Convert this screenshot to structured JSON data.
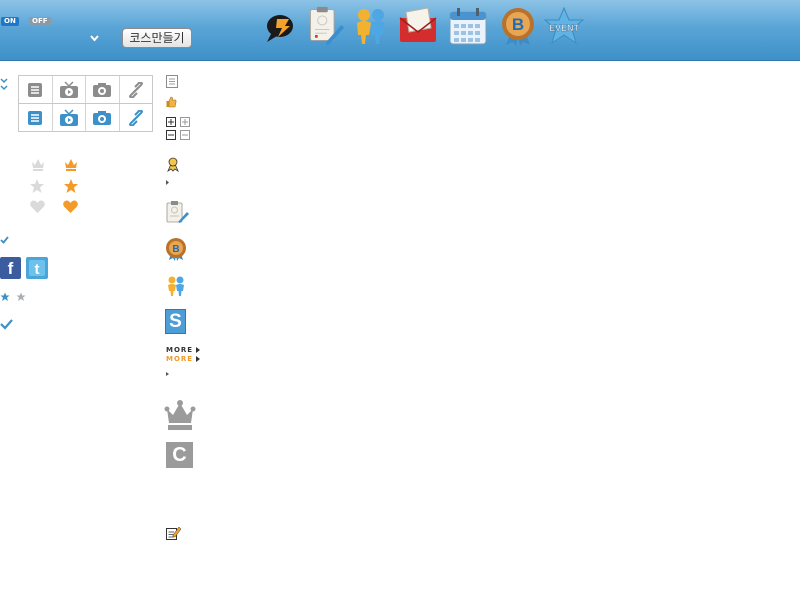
{
  "topbar": {
    "toggle_on": "ON",
    "toggle_off": "OFF",
    "course_button_label": "코스만들기",
    "event_label": "EVENT",
    "badge_letter": "B",
    "icons": [
      "speech-bubble-icon",
      "clipboard-icon",
      "friends-icon",
      "mail-icon",
      "calendar-icon",
      "badge-b-icon",
      "event-star-icon"
    ]
  },
  "sidebar_links": {
    "more_label_1": "MORE",
    "more_label_2": "MORE"
  },
  "labels": {
    "c_letter": "C",
    "s_letter": "S",
    "fb_letter": "f",
    "tw_letter": "t"
  },
  "colors": {
    "accent_blue": "#3d90c8",
    "accent_orange": "#f39a2b",
    "gray_icon": "#9e9e9e",
    "light_gray_icon": "#d9d9d9"
  }
}
